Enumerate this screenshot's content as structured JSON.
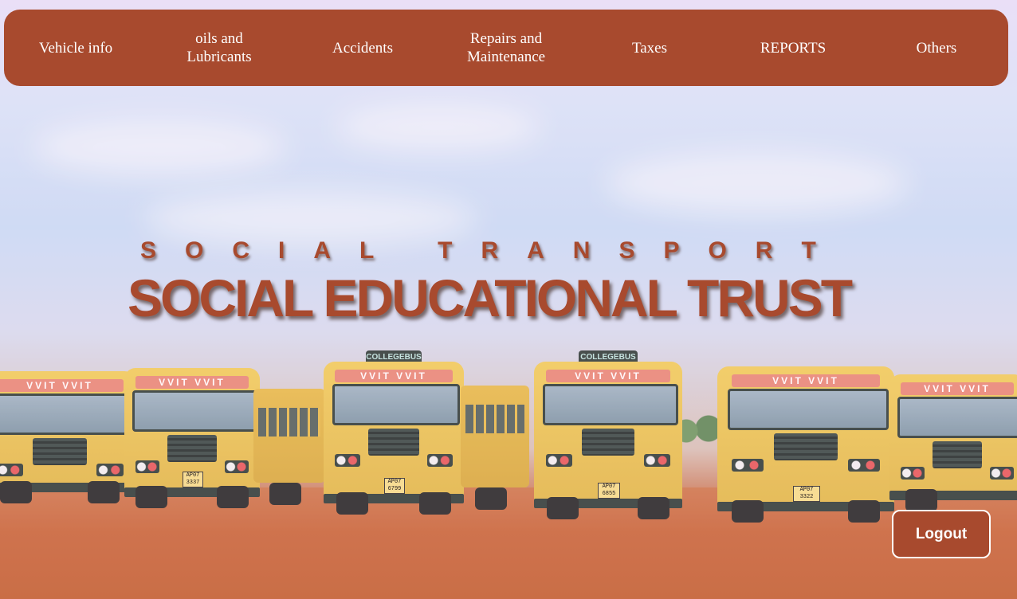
{
  "nav": {
    "items": [
      {
        "label": "Vehicle info"
      },
      {
        "label": "oils and\nLubricants"
      },
      {
        "label": "Accidents"
      },
      {
        "label": "Repairs and\nMaintenance"
      },
      {
        "label": "Taxes"
      },
      {
        "label": "REPORTS"
      },
      {
        "label": "Others"
      }
    ]
  },
  "hero": {
    "tagline": "SOCIAL TRANSPORT",
    "headline": "SOCIAL EDUCATIONAL TRUST",
    "image_description": "row of yellow VVIT college buses parked on red soil ground under a pale sky",
    "bus_texts": {
      "band": "VVIT VVIT",
      "roof_sign": "COLLEGEBUS"
    }
  },
  "actions": {
    "logout_label": "Logout"
  },
  "colors": {
    "brand": "#a84a2e",
    "nav_text": "#ffffff",
    "logout_border": "#ffffff"
  }
}
